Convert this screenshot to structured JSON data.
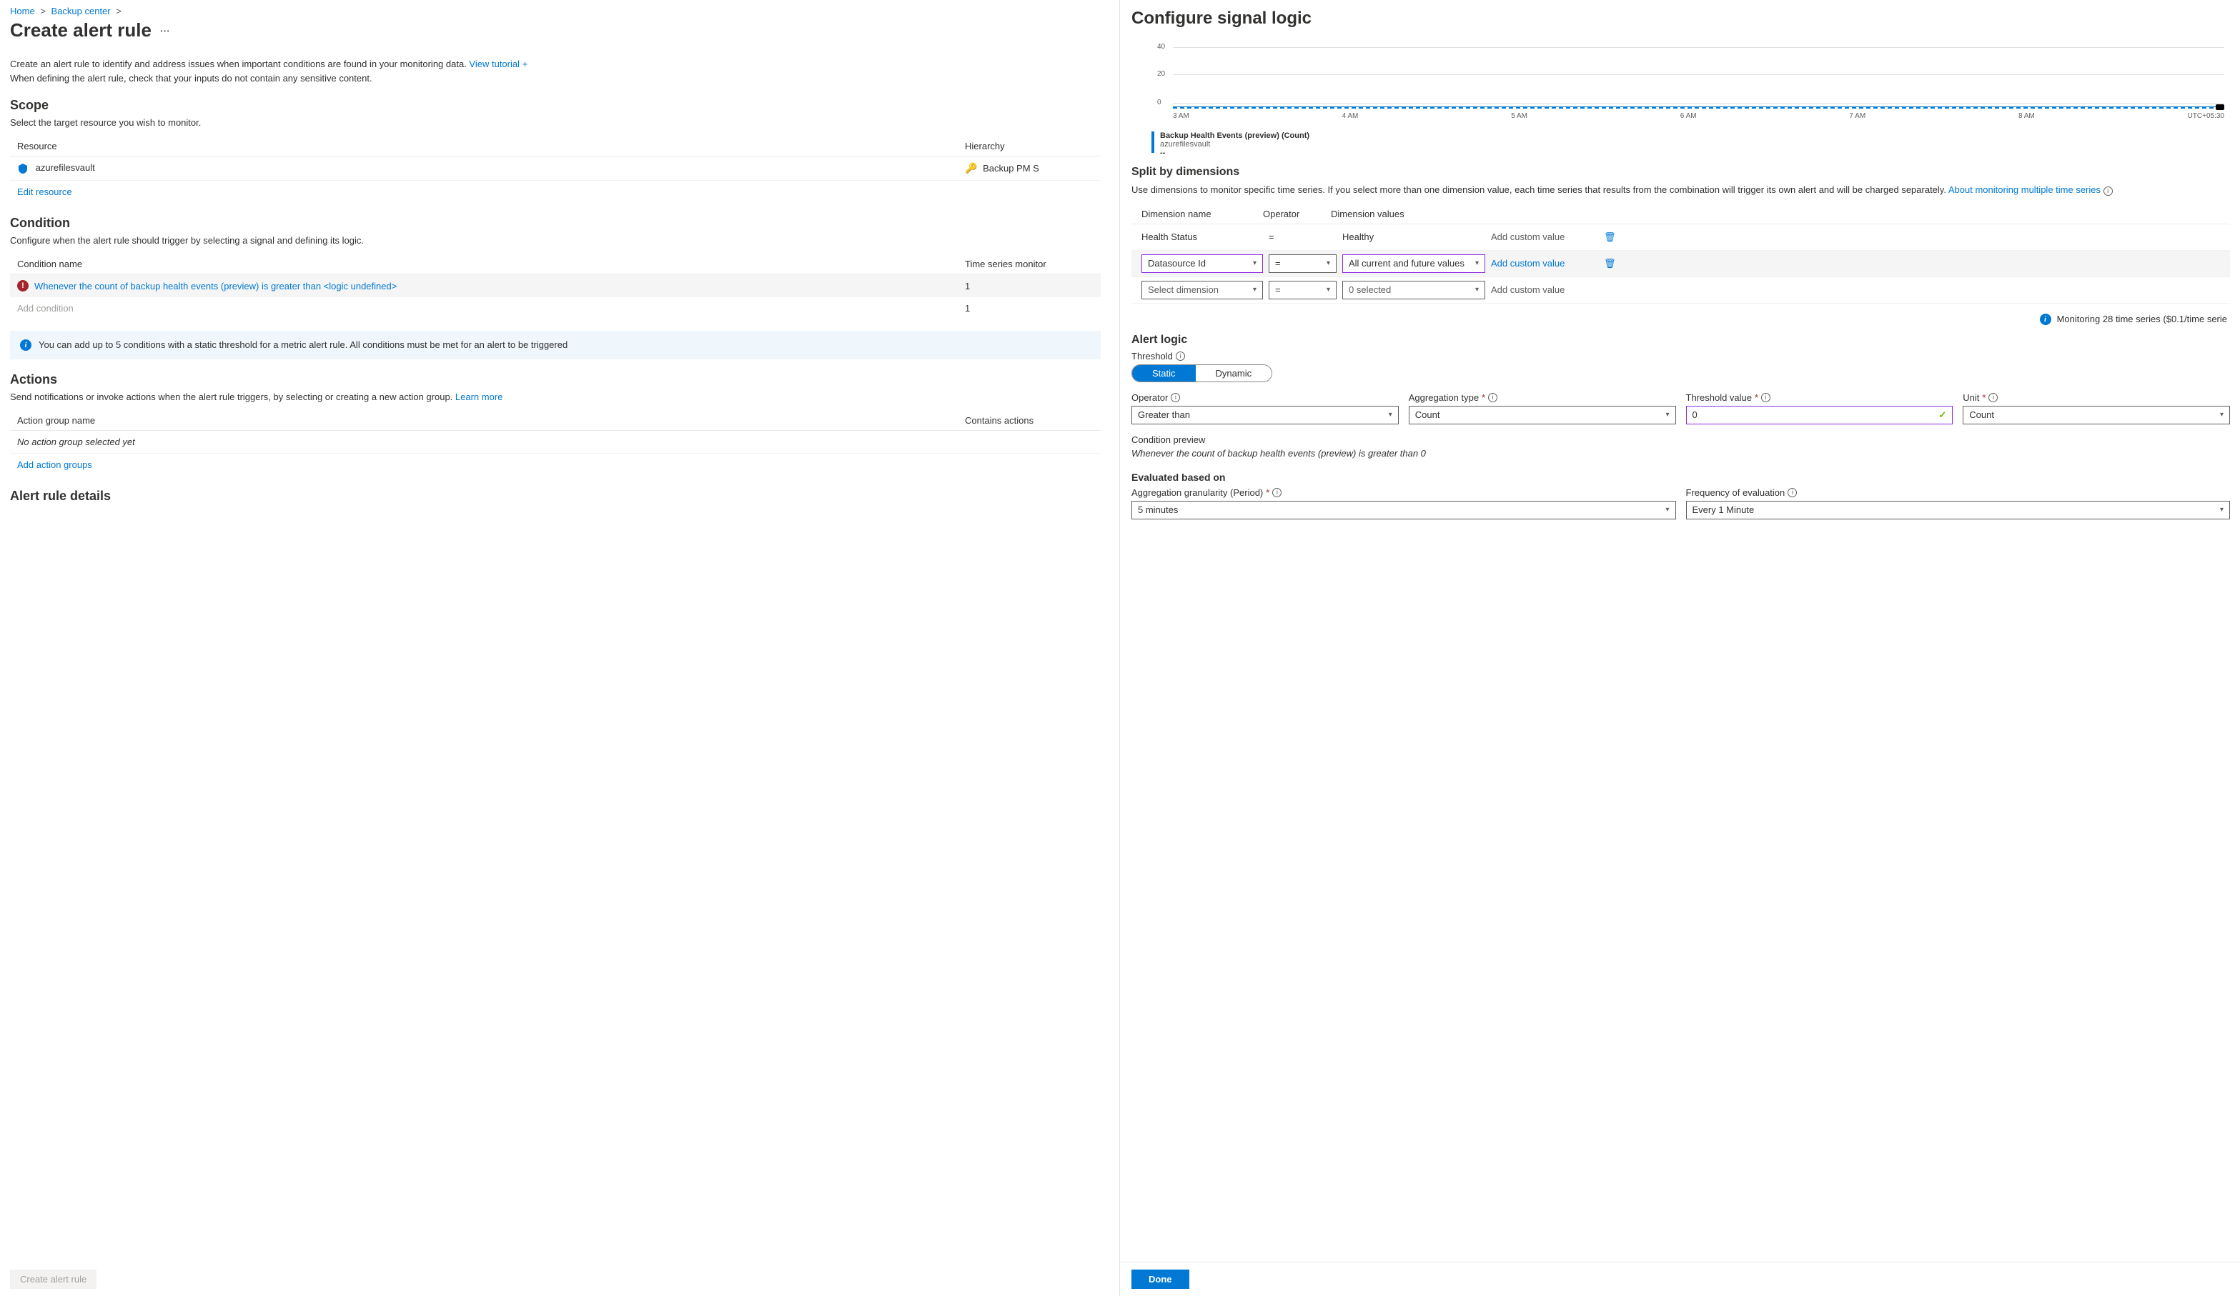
{
  "breadcrumb": {
    "home": "Home",
    "center": "Backup center"
  },
  "page": {
    "title": "Create alert rule",
    "intro1": "Create an alert rule to identify and address issues when important conditions are found in your monitoring data. ",
    "tutorial_link": "View tutorial +",
    "intro2": "When defining the alert rule, check that your inputs do not contain any sensitive content."
  },
  "scope": {
    "heading": "Scope",
    "sub": "Select the target resource you wish to monitor.",
    "col_resource": "Resource",
    "col_hierarchy": "Hierarchy",
    "resource_name": "azurefilesvault",
    "hierarchy_name": "Backup PM S",
    "edit_link": "Edit resource"
  },
  "condition": {
    "heading": "Condition",
    "sub": "Configure when the alert rule should trigger by selecting a signal and defining its logic.",
    "col_name": "Condition name",
    "col_ts": "Time series monitor",
    "row1_text": "Whenever the count of backup health events (preview) is greater than <logic undefined>",
    "row1_count": "1",
    "add_link": "Add condition",
    "add_count": "1",
    "info_text": "You can add up to 5 conditions with a static threshold for a metric alert rule. All conditions must be met for an alert to be triggered"
  },
  "actions": {
    "heading": "Actions",
    "sub_prefix": "Send notifications or invoke actions when the alert rule triggers, by selecting or creating a new action group. ",
    "learn_more": "Learn more",
    "col_name": "Action group name",
    "col_contains": "Contains actions",
    "empty_text": "No action group selected yet",
    "add_link": "Add action groups"
  },
  "details": {
    "heading": "Alert rule details"
  },
  "footer": {
    "create_btn": "Create alert rule"
  },
  "signal": {
    "title": "Configure signal logic",
    "chart_data": {
      "type": "line",
      "y_ticks": [
        "40",
        "20",
        "0"
      ],
      "x_ticks": [
        "3 AM",
        "4 AM",
        "5 AM",
        "6 AM",
        "7 AM",
        "8 AM",
        "UTC+05:30"
      ],
      "series": [
        {
          "name": "Backup Health Events (preview) (Count)",
          "resource": "azurefilesvault",
          "value_display": "--",
          "values": [
            0,
            0,
            0,
            0,
            0,
            0
          ]
        }
      ]
    },
    "split": {
      "heading": "Split by dimensions",
      "desc_prefix": "Use dimensions to monitor specific time series. If you select more than one dimension value, each time series that results from the combination will trigger its own alert and will be charged separately. ",
      "link": "About monitoring multiple time series",
      "col_name": "Dimension name",
      "col_op": "Operator",
      "col_val": "Dimension values",
      "rows": [
        {
          "name": "Health Status",
          "op": "=",
          "val": "Healthy",
          "custom": "Add custom value",
          "readonly": true
        },
        {
          "name": "Datasource Id",
          "op": "=",
          "val": "All current and future values",
          "custom": "Add custom value",
          "active": true
        },
        {
          "name": "Select dimension",
          "op": "=",
          "val": "0 selected",
          "custom": "Add custom value",
          "placeholder": true
        }
      ]
    },
    "monitoring_note": "Monitoring 28 time series ($0.1/time serie",
    "alert_logic": {
      "heading": "Alert logic",
      "threshold_label": "Threshold",
      "pill_static": "Static",
      "pill_dynamic": "Dynamic",
      "operator_label": "Operator",
      "operator_value": "Greater than",
      "agg_label": "Aggregation type",
      "agg_value": "Count",
      "threshold_val_label": "Threshold value",
      "threshold_val": "0",
      "unit_label": "Unit",
      "unit_value": "Count",
      "preview_heading": "Condition preview",
      "preview_text": "Whenever the count of backup health events (preview) is greater than 0",
      "eval_heading": "Evaluated based on",
      "period_label": "Aggregation granularity (Period)",
      "period_value": "5 minutes",
      "freq_label": "Frequency of evaluation",
      "freq_value": "Every 1 Minute"
    },
    "done_btn": "Done"
  }
}
